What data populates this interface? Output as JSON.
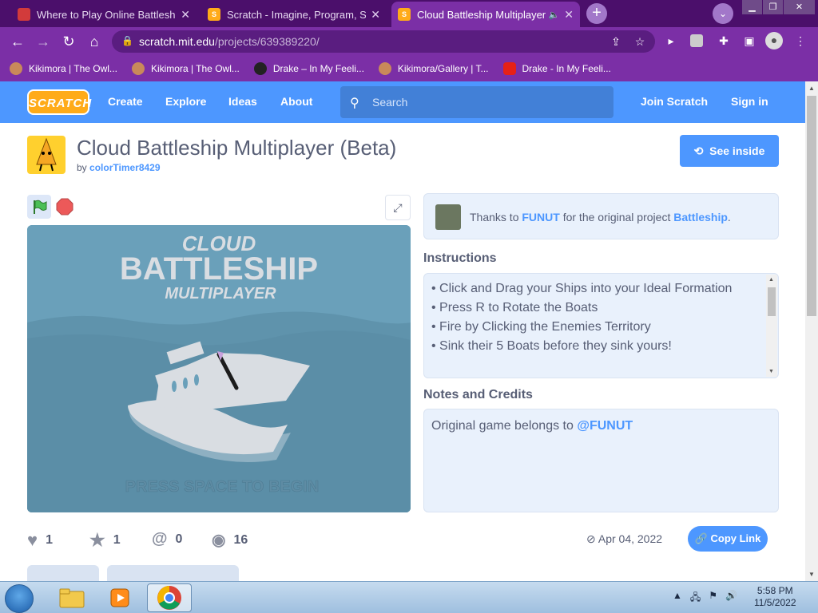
{
  "browser": {
    "tabs": [
      {
        "title": "Where to Play Online Battleship",
        "favicon_color": "#d23b3b"
      },
      {
        "title": "Scratch - Imagine, Program, Sha",
        "favicon_color": "#ffab19"
      },
      {
        "title": "Cloud Battleship Multiplayer",
        "favicon_color": "#ffab19"
      }
    ],
    "url_host": "scratch.mit.edu",
    "url_path": "/projects/639389220/",
    "bookmarks": [
      {
        "label": "Kikimora | The Owl...",
        "icon_color": "#c9895a"
      },
      {
        "label": "Kikimora | The Owl...",
        "icon_color": "#c9895a"
      },
      {
        "label": "Drake – In My Feeli...",
        "icon_color": "#222222"
      },
      {
        "label": "Kikimora/Gallery | T...",
        "icon_color": "#c9895a"
      },
      {
        "label": "Drake - In My Feeli...",
        "icon_color": "#e62117"
      }
    ]
  },
  "scratch_nav": {
    "logo": "SCRATCH",
    "links": [
      "Create",
      "Explore",
      "Ideas",
      "About"
    ],
    "search_placeholder": "Search",
    "join": "Join Scratch",
    "signin": "Sign in"
  },
  "project": {
    "title": "Cloud Battleship Multiplayer (Beta)",
    "by_prefix": "by",
    "author": "colorTimer8429",
    "see_inside": "See inside",
    "credits": {
      "prefix": "Thanks to",
      "user": "FUNUT",
      "middle": "for the original project",
      "project": "Battleship",
      "suffix": "."
    },
    "instructions_heading": "Instructions",
    "instructions": [
      "• Click and Drag your Ships into your Ideal Formation",
      "• Press R to Rotate the Boats",
      "• Fire by Clicking the Enemies Territory",
      "• Sink their 5 Boats before they sink yours!"
    ],
    "notes_heading": "Notes and Credits",
    "notes_prefix": "Original game belongs to",
    "notes_user": "@FUNUT",
    "stats": {
      "loves": "1",
      "favorites": "1",
      "remixes": "0",
      "views": "16"
    },
    "date": "Apr 04, 2022",
    "copy_link": "Copy Link",
    "stage_text": {
      "line1": "CLOUD",
      "line2": "BATTLESHIP",
      "line3": "MULTIPLAYER",
      "prompt": "PRESS SPACE TO BEGIN"
    }
  },
  "taskbar": {
    "time": "5:58 PM",
    "date": "11/5/2022"
  },
  "colors": {
    "scratch_blue": "#4d97ff",
    "chrome_purple": "#7b2fa6",
    "stage_bg": "#6a9fb8"
  }
}
